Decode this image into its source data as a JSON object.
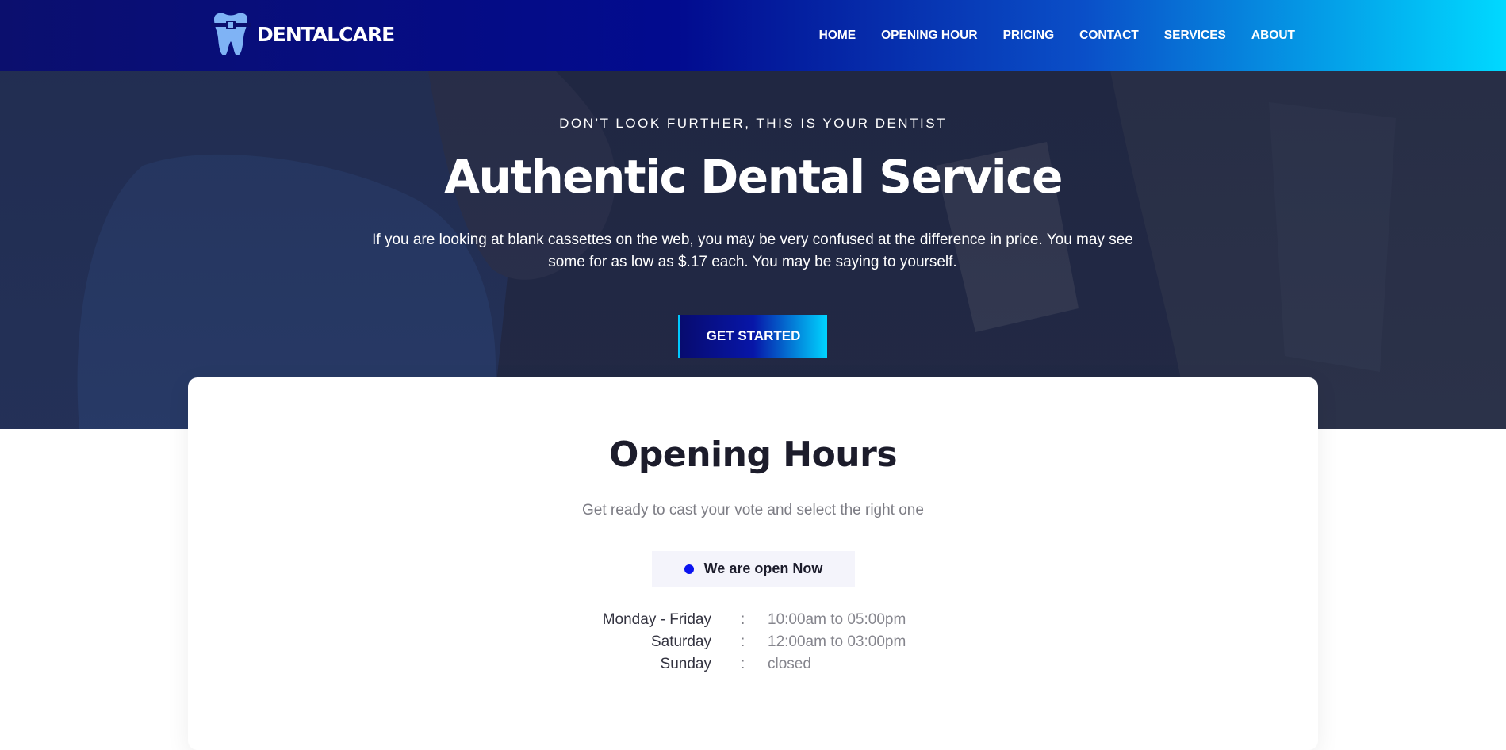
{
  "header": {
    "logo_text": "DENTALCARE",
    "logo_icon": "tooth-icon",
    "nav": [
      {
        "label": "HOME"
      },
      {
        "label": "OPENING HOUR"
      },
      {
        "label": "PRICING"
      },
      {
        "label": "CONTACT"
      },
      {
        "label": "SERVICES"
      },
      {
        "label": "ABOUT"
      }
    ]
  },
  "hero": {
    "eyebrow": "DON’T LOOK FURTHER, THIS IS YOUR DENTIST",
    "title": "Authentic Dental Service",
    "text": "If you are looking at blank cassettes on the web, you may be very confused at the difference in price. You may see some for as low as $.17 each. You may be saying to yourself.",
    "button_label": "GET STARTED"
  },
  "opening_hours": {
    "title": "Opening Hours",
    "subtitle": "Get ready to cast your vote and select the right one",
    "status": "We are open Now",
    "rows": [
      {
        "day": "Monday - Friday",
        "sep": ":",
        "time": "10:00am to 05:00pm"
      },
      {
        "day": "Saturday",
        "sep": ":",
        "time": "12:00am to 03:00pm"
      },
      {
        "day": "Sunday",
        "sep": ":",
        "time": "closed"
      }
    ]
  },
  "colors": {
    "brand_dark": "#0b0f6e",
    "brand_light": "#00d9ff",
    "status_dot": "#0a13f0"
  }
}
